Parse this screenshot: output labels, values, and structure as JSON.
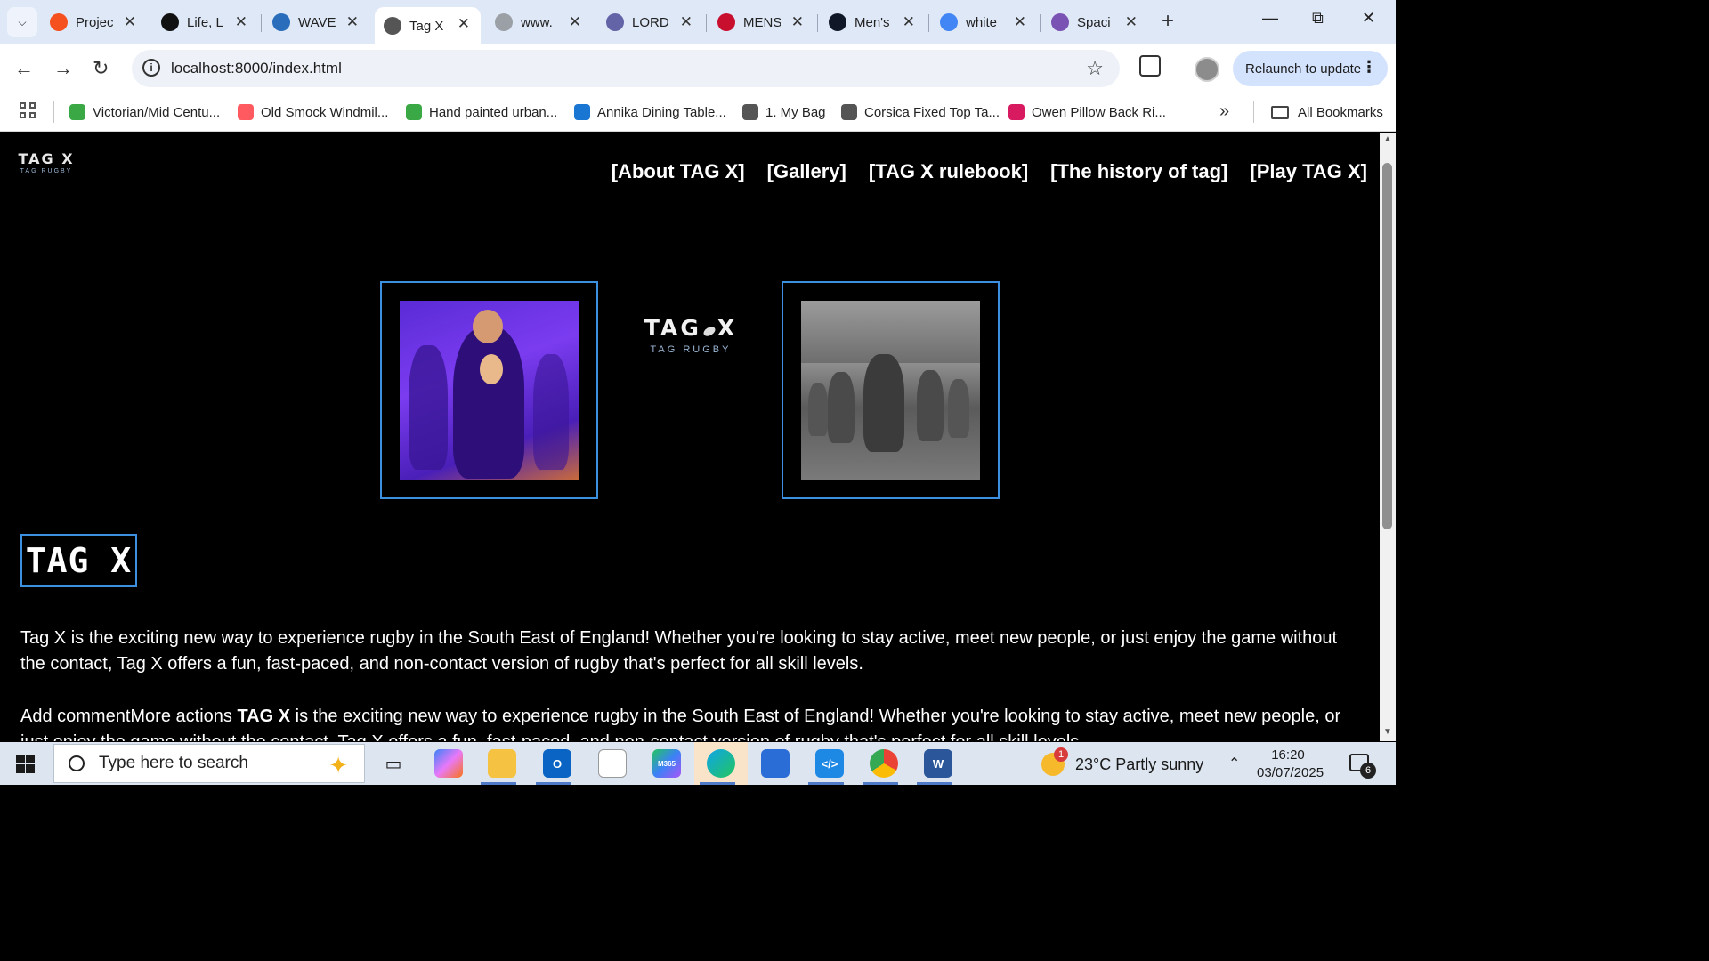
{
  "browser": {
    "tabs": [
      {
        "title": "Projec",
        "favicon": "opera-circle-icon",
        "color": "#f4511e"
      },
      {
        "title": "Life, L",
        "favicon": "threads-icon",
        "color": "#111111"
      },
      {
        "title": "WAVE",
        "favicon": "wordpress-icon",
        "color": "#2a6ebb"
      },
      {
        "title": "Tag X",
        "favicon": "globe-icon",
        "color": "#555555",
        "active": true
      },
      {
        "title": "www.",
        "favicon": "rd-icon",
        "color": "#9aa0a6"
      },
      {
        "title": "LORD",
        "favicon": "teams-icon",
        "color": "#6264a7"
      },
      {
        "title": "MENS",
        "favicon": "canterbury-icon",
        "color": "#c8102e"
      },
      {
        "title": "Men's",
        "favicon": "ct-icon",
        "color": "#101828"
      },
      {
        "title": "white",
        "favicon": "google-icon",
        "color": "#4285f4"
      },
      {
        "title": "Spaci",
        "favicon": "bootstrap-icon",
        "color": "#7952b3"
      }
    ],
    "url": "localhost:8000/index.html",
    "relaunch_label": "Relaunch to update",
    "bookmarks": [
      {
        "label": "Victorian/Mid Centu...",
        "color": "#3aa845"
      },
      {
        "label": "Old Smock Windmil...",
        "color": "#ff5a5f"
      },
      {
        "label": "Hand painted urban...",
        "color": "#3aa845"
      },
      {
        "label": "Annika Dining Table...",
        "color": "#1976d2"
      },
      {
        "label": "1. My Bag",
        "color": "#555555"
      },
      {
        "label": "Corsica Fixed Top Ta...",
        "color": "#555555"
      },
      {
        "label": "Owen Pillow Back Ri...",
        "color": "#d81b60"
      }
    ],
    "all_bookmarks_label": "All Bookmarks"
  },
  "site": {
    "logo_word": "TAG X",
    "logo_sub": "TAG RUGBY",
    "nav": [
      "[About TAG X]",
      "[Gallery]",
      "[TAG X rulebook]",
      "[The history of tag]",
      "[Play TAG X]"
    ],
    "hero_logo_word_left": "TAG",
    "hero_logo_word_right": "X",
    "hero_logo_sub": "TAG RUGBY",
    "heading": "TAG X",
    "paragraph_1": "Tag X is the exciting new way to experience rugby in the South East of England! Whether you're looking to stay active, meet new people, or just enjoy the game without the contact, Tag X offers a fun, fast-paced, and non-contact version of rugby that's perfect for all skill levels.",
    "paragraph_2_prefix": "Add commentMore actions ",
    "paragraph_2_bold": "TAG X",
    "paragraph_2_rest": " is the exciting new way to experience rugby in the South East of England! Whether you're looking to stay active, meet new people, or just enjoy the game without the contact, Tag X offers a fun, fast-paced, and non-contact version of rugby that's perfect for all skill levels."
  },
  "taskbar": {
    "search_placeholder": "Type here to search",
    "weather_temp": "23°C",
    "weather_desc": "Partly sunny",
    "weather_badge": "1",
    "time": "16:20",
    "date": "03/07/2025",
    "notifications": "6"
  }
}
